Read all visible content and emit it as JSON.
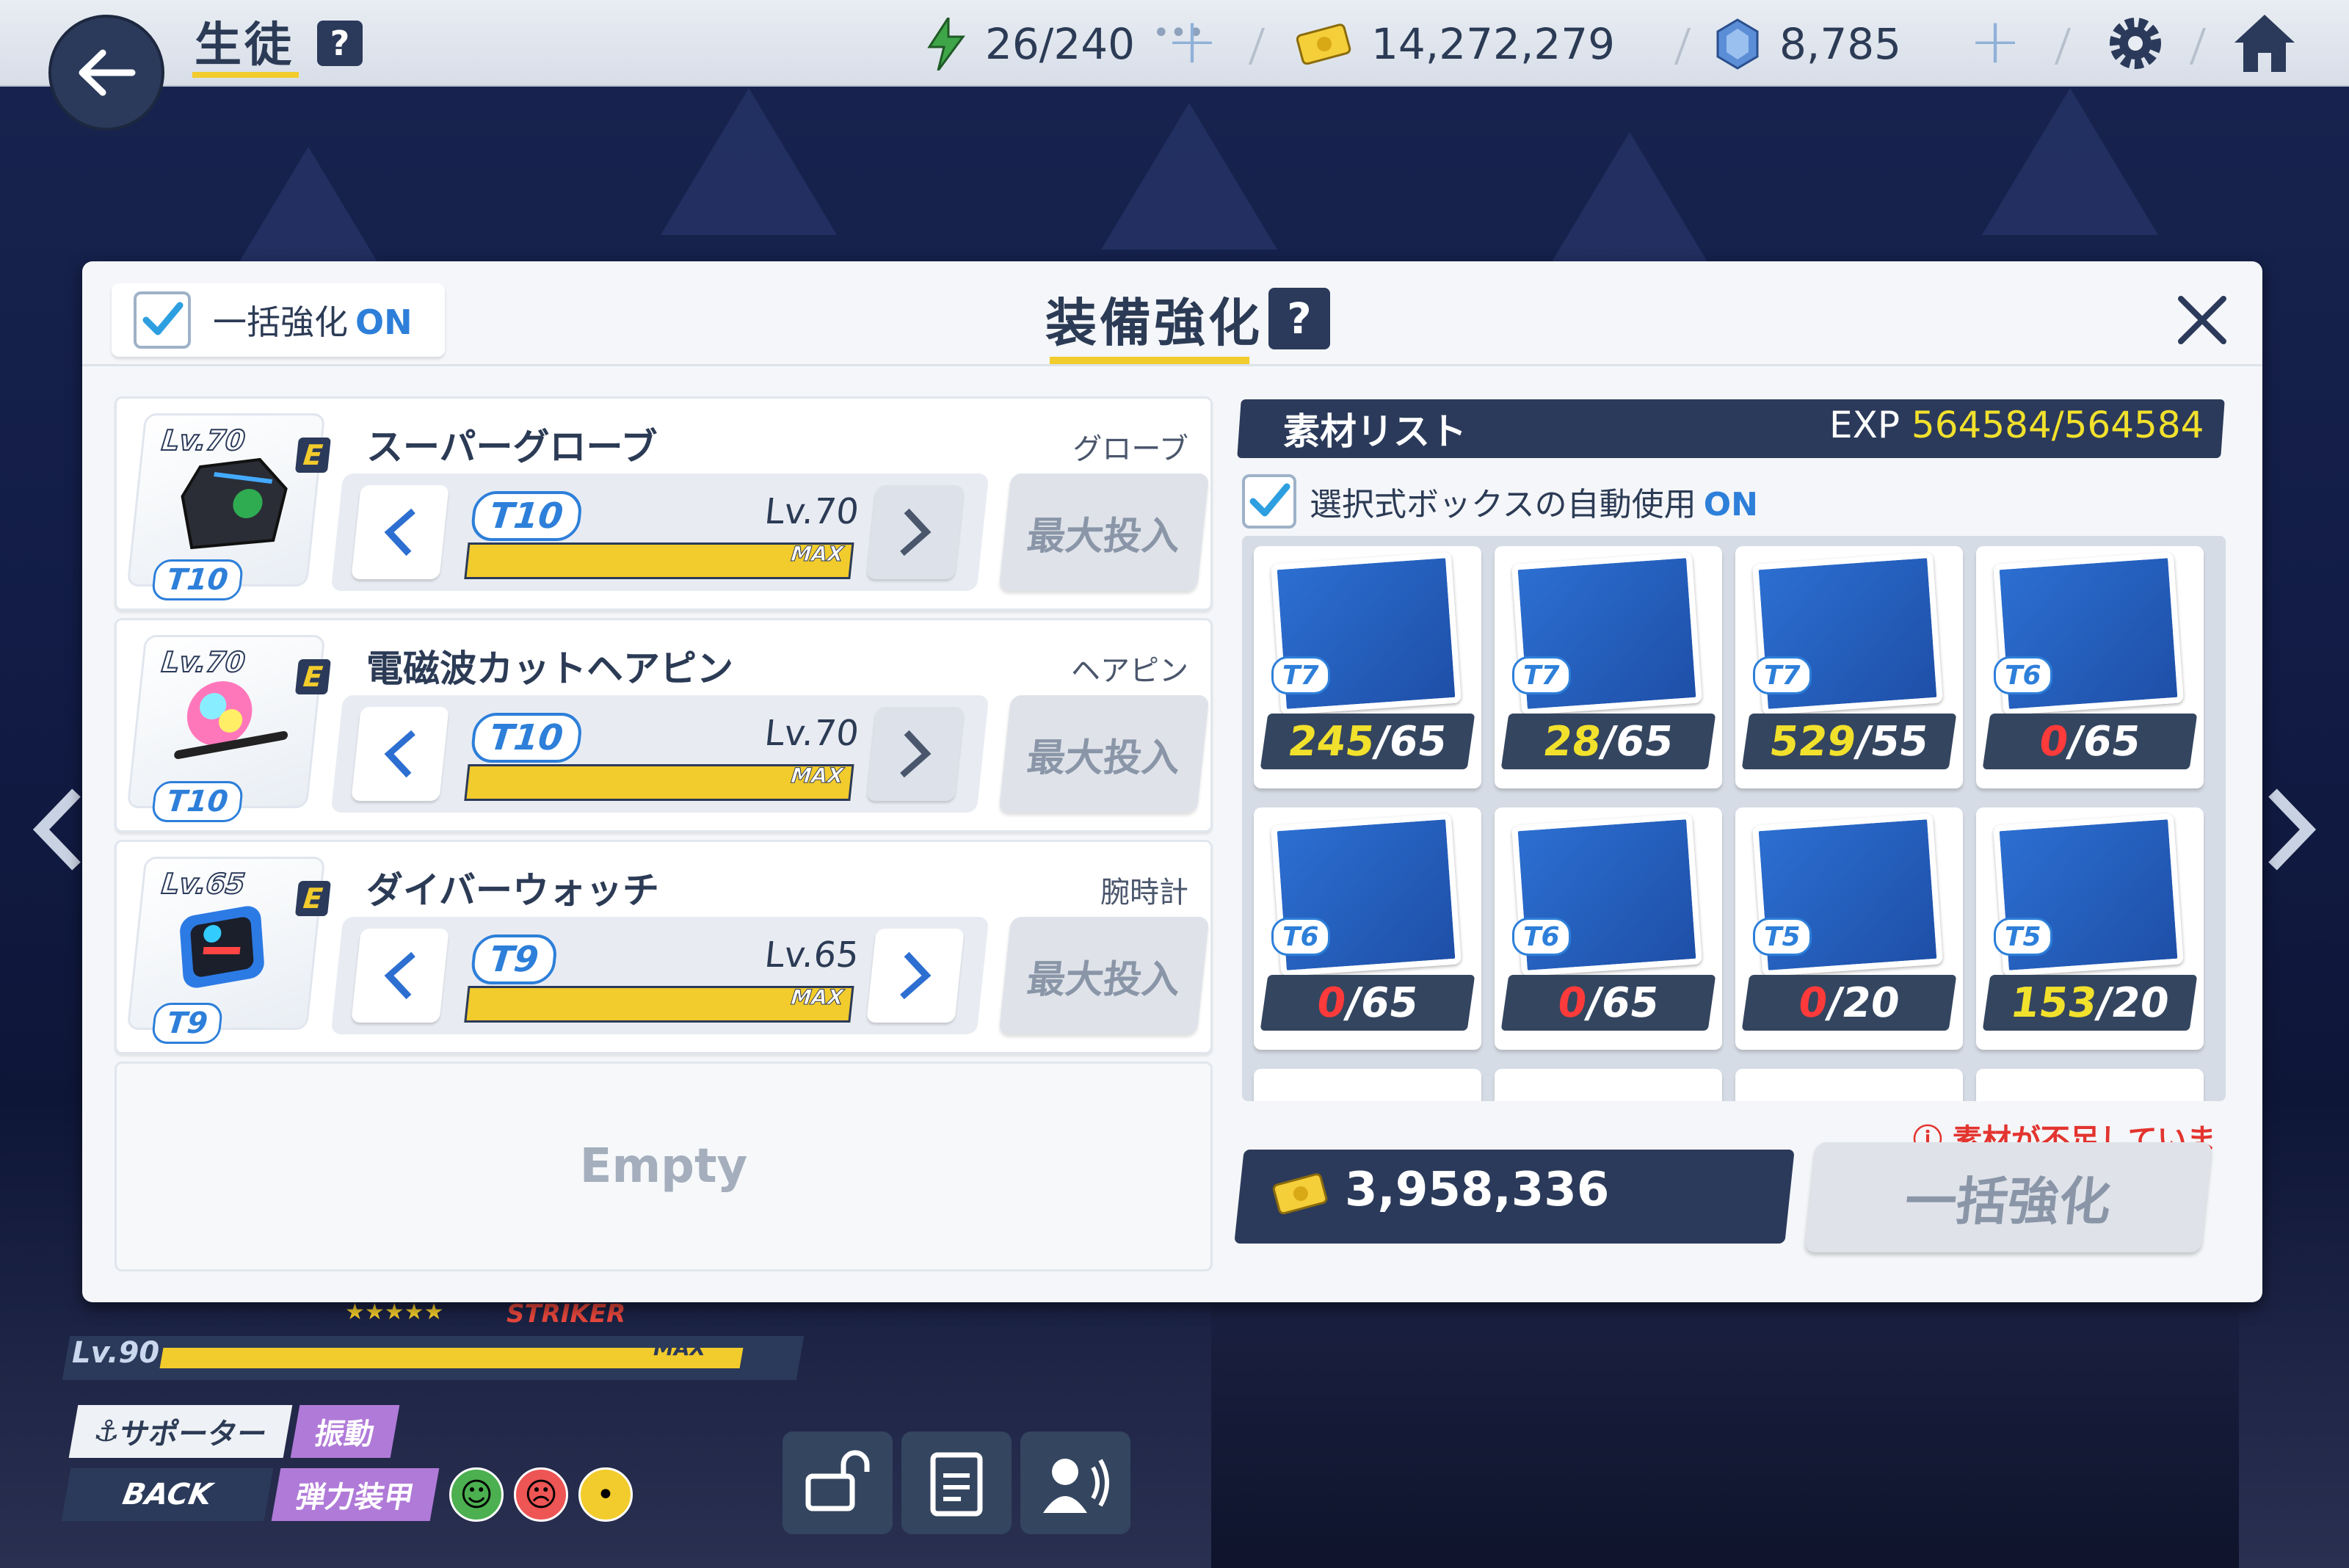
{
  "header": {
    "title": "生徒",
    "ap": "26/240",
    "credits": "14,272,279",
    "gems": "8,785"
  },
  "student": {
    "level": "Lv.90",
    "level_max": "MAX",
    "role": "STRIKER",
    "tag_support": "サポーター",
    "tag_vibration": "振動",
    "tag_back": "BACK",
    "tag_armor": "弾力装甲"
  },
  "modal": {
    "bulk_label": "一括強化",
    "bulk_state": "ON",
    "title": "装備強化",
    "help": "?",
    "equipment": [
      {
        "level": "Lv.70",
        "grade": "E",
        "tier": "T10",
        "name": "スーパーグローブ",
        "type": "グローブ",
        "tier_pill": "T10",
        "lv": "Lv.70",
        "max": "MAX",
        "max_button": "最大投入"
      },
      {
        "level": "Lv.70",
        "grade": "E",
        "tier": "T10",
        "name": "電磁波カットヘアピン",
        "type": "ヘアピン",
        "tier_pill": "T10",
        "lv": "Lv.70",
        "max": "MAX",
        "max_button": "最大投入"
      },
      {
        "level": "Lv.65",
        "grade": "E",
        "tier": "T9",
        "name": "ダイバーウォッチ",
        "type": "腕時計",
        "tier_pill": "T9",
        "lv": "Lv.65",
        "max": "MAX",
        "max_button": "最大投入"
      }
    ],
    "empty_label": "Empty",
    "materials": {
      "title": "素材リスト",
      "exp_label": "EXP",
      "exp_value": "564584/564584",
      "auto_label": "選択式ボックスの自動使用",
      "auto_state": "ON",
      "items": [
        {
          "tier": "T7",
          "have": "245",
          "need": "/65",
          "have_color": "yellow"
        },
        {
          "tier": "T7",
          "have": "28",
          "need": "/65",
          "have_color": "yellow"
        },
        {
          "tier": "T7",
          "have": "529",
          "need": "/55",
          "have_color": "yellow"
        },
        {
          "tier": "T6",
          "have": "0",
          "need": "/65",
          "have_color": "red"
        },
        {
          "tier": "T6",
          "have": "0",
          "need": "/65",
          "have_color": "red"
        },
        {
          "tier": "T6",
          "have": "0",
          "need": "/65",
          "have_color": "red"
        },
        {
          "tier": "T5",
          "have": "0",
          "need": "/20",
          "have_color": "red"
        },
        {
          "tier": "T5",
          "have": "153",
          "need": "/20",
          "have_color": "yellow"
        }
      ],
      "warning": "素材が不足しています。",
      "cost": "3,958,336",
      "bulk_button": "一括強化"
    }
  },
  "colors": {
    "accent": "#2d7fd9",
    "dark": "#2b3a5a",
    "yellow": "#f2cb2c",
    "red": "#ff3a3a"
  }
}
